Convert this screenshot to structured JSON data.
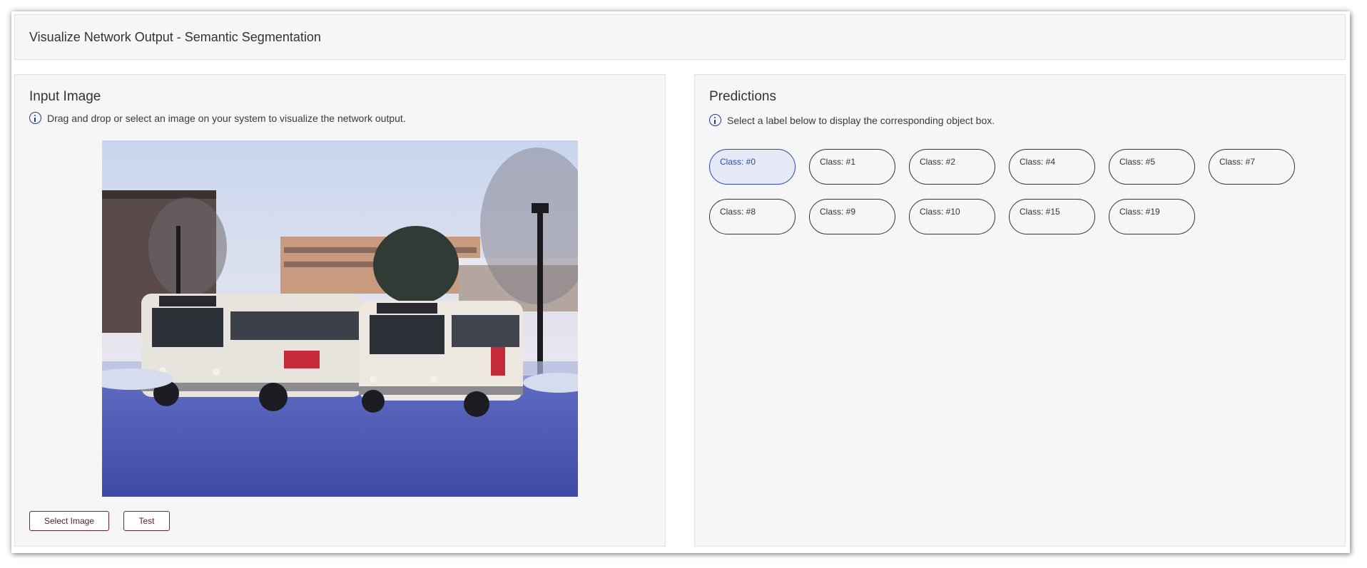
{
  "app": {
    "title": "Visualize Network Output - Semantic Segmentation"
  },
  "input_panel": {
    "title": "Input Image",
    "info_text": "Drag and drop or select an image on your system to visualize the network output.",
    "info_icon": "info-circle-icon",
    "buttons": {
      "select_label": "Select Image",
      "test_label": "Test"
    }
  },
  "predictions_panel": {
    "title": "Predictions",
    "info_text": "Select a label below to display the corresponding object box.",
    "info_icon": "info-circle-icon",
    "classes": [
      {
        "label": "Class: #0",
        "selected": true
      },
      {
        "label": "Class: #1",
        "selected": false
      },
      {
        "label": "Class: #2",
        "selected": false
      },
      {
        "label": "Class: #4",
        "selected": false
      },
      {
        "label": "Class: #5",
        "selected": false
      },
      {
        "label": "Class: #7",
        "selected": false
      },
      {
        "label": "Class: #8",
        "selected": false
      },
      {
        "label": "Class: #9",
        "selected": false
      },
      {
        "label": "Class: #10",
        "selected": false
      },
      {
        "label": "Class: #15",
        "selected": false
      },
      {
        "label": "Class: #19",
        "selected": false
      }
    ]
  },
  "colors": {
    "accent": "#2a45b8",
    "button_border": "#7a1f3a",
    "panel_bg": "#f6f6f6"
  }
}
